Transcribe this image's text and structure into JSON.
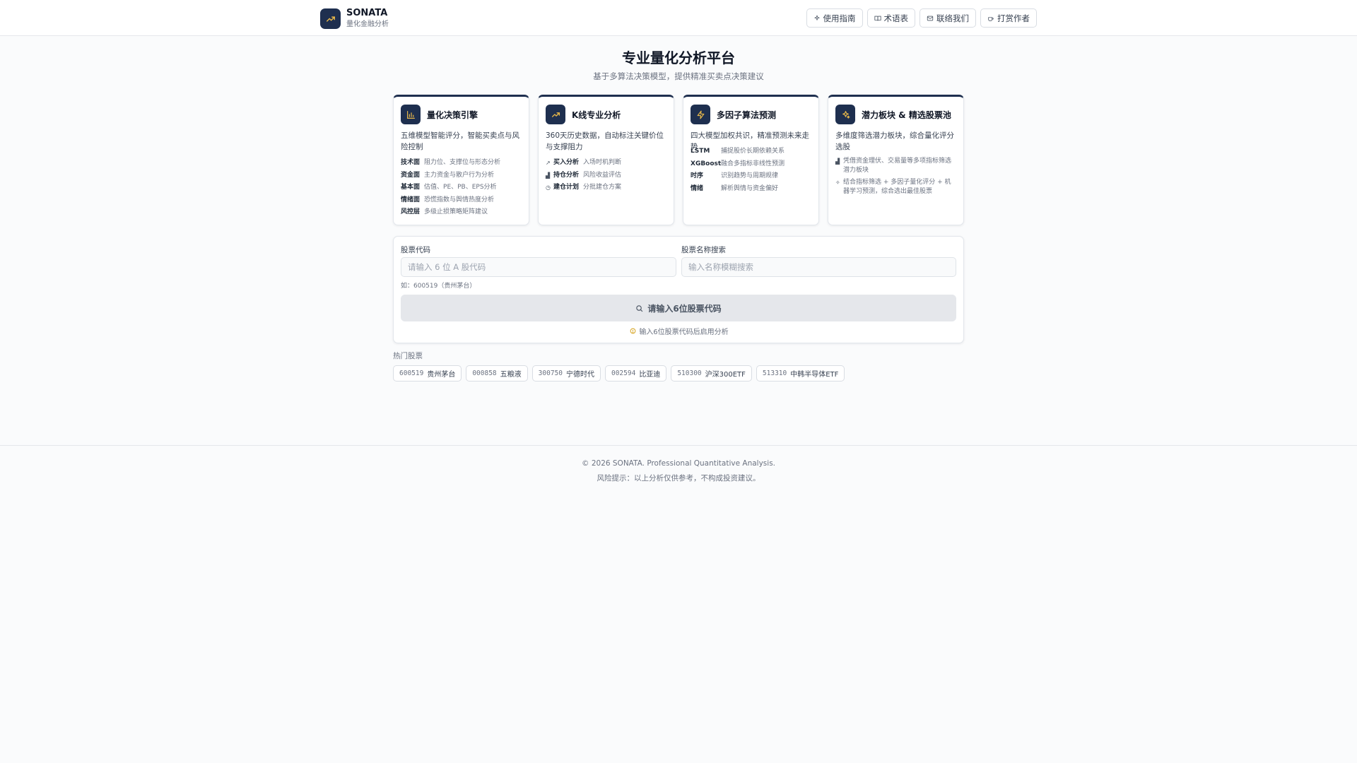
{
  "brand": {
    "name": "SONATA",
    "subtitle": "量化金融分析"
  },
  "nav": [
    {
      "label": "使用指南",
      "icon": "sparkle-icon"
    },
    {
      "label": "术语表",
      "icon": "book-icon"
    },
    {
      "label": "联络我们",
      "icon": "mail-icon"
    },
    {
      "label": "打赏作者",
      "icon": "coffee-icon"
    }
  ],
  "hero": {
    "title": "专业量化分析平台",
    "subtitle": "基于多算法决策模型，提供精准买卖点决策建议"
  },
  "cards": [
    {
      "title": "量化决策引擎",
      "icon": "bar-chart-icon",
      "desc": "五维模型智能评分，智能买卖点与风险控制",
      "items": [
        {
          "key": "技术面",
          "value": "阻力位、支撑位与形态分析"
        },
        {
          "key": "资金面",
          "value": "主力资金与散户行为分析"
        },
        {
          "key": "基本面",
          "value": "估值、PE、PB、EPS分析"
        },
        {
          "key": "情绪面",
          "value": "恐慌指数与舆情热度分析"
        },
        {
          "key": "风控层",
          "value": "多级止损策略矩阵建议"
        }
      ]
    },
    {
      "title": "K线专业分析",
      "icon": "trend-up-icon",
      "desc": "360天历史数据，自动标注关键价位与支撑阻力",
      "items": [
        {
          "icon": "↗",
          "key": "买入分析",
          "value": "入场时机判断"
        },
        {
          "icon": "▟",
          "key": "持仓分析",
          "value": "风险收益评估"
        },
        {
          "icon": "◷",
          "key": "建仓计划",
          "value": "分批建仓方案"
        }
      ]
    },
    {
      "title": "多因子算法预测",
      "icon": "lightning-icon",
      "desc": "四大模型加权共识，精准预测未来走势",
      "items": [
        {
          "key": "LSTM",
          "value": "捕捉股价长期依赖关系"
        },
        {
          "key": "XGBoost",
          "value": "融合多指标非线性预测"
        },
        {
          "key": "时序",
          "value": "识别趋势与周期规律"
        },
        {
          "key": "情绪",
          "value": "解析舆情与资金偏好"
        }
      ]
    },
    {
      "title": "潜力板块 & 精选股票池",
      "icon": "sparkle-icon",
      "desc": "多维度筛选潜力板块，综合量化评分选股",
      "items": [
        {
          "icon": "▟",
          "value": "凭借资金理伏、交易量等多项指标筛选潜力板块"
        },
        {
          "icon": "✧",
          "value": "结合指标筛选 + 多因子量化评分 + 机器学习预测，综合选出最佳股票"
        }
      ]
    }
  ],
  "search": {
    "code_label": "股票代码",
    "code_placeholder": "请输入 6 位 A 股代码",
    "code_value": "",
    "name_label": "股票名称搜索",
    "name_placeholder": "输入名称模糊搜索",
    "name_value": "",
    "hint": "如：600519（贵州茅台）",
    "button_label": "请输入6位股票代码",
    "note": "输入6位股票代码后启用分析"
  },
  "hot": {
    "title": "热门股票",
    "items": [
      {
        "code": "600519",
        "name": "贵州茅台"
      },
      {
        "code": "000858",
        "name": "五粮液"
      },
      {
        "code": "300750",
        "name": "宁德时代"
      },
      {
        "code": "002594",
        "name": "比亚迪"
      },
      {
        "code": "510300",
        "name": "沪深300ETF"
      },
      {
        "code": "513310",
        "name": "中韩半导体ETF"
      }
    ]
  },
  "footer": {
    "copyright": "© 2026 SONATA. Professional Quantitative Analysis.",
    "risk": "风险提示：以上分析仅供参考，不构成投资建议。"
  },
  "colors": {
    "brand": "#1e2f4f",
    "accent": "#e8b84a"
  }
}
